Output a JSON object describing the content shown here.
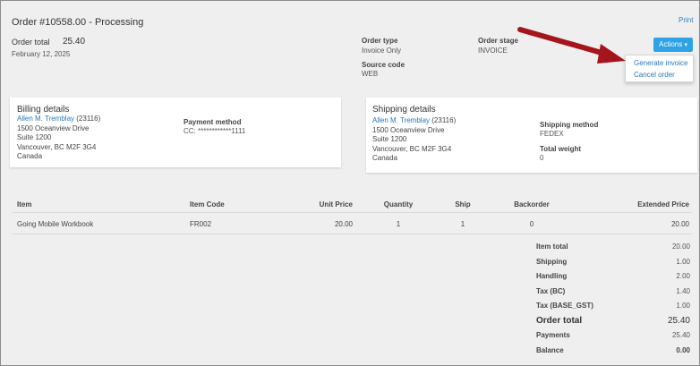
{
  "header": {
    "title": "Order #10558.00 - Processing",
    "print_label": "Print",
    "order_total_label": "Order total",
    "order_total_value": "25.40",
    "order_date": "February 12, 2025",
    "order_type_label": "Order type",
    "order_type_value": "Invoice Only",
    "source_code_label": "Source code",
    "source_code_value": "WEB",
    "order_stage_label": "Order stage",
    "order_stage_value": "INVOICE"
  },
  "actions": {
    "button_label": "Actions",
    "caret": "▾",
    "menu": [
      "Generate invoice",
      "Cancel order"
    ]
  },
  "billing": {
    "title": "Billing details",
    "customer_name": "Allen M. Tremblay",
    "customer_id": "(23116)",
    "address": [
      "1500 Oceanview Drive",
      "Suite 1200",
      "Vancouver, BC M2F 3G4",
      "Canada"
    ],
    "payment_method_label": "Payment method",
    "payment_method_value": "CC: ************1111"
  },
  "shipping": {
    "title": "Shipping details",
    "customer_name": "Allen M. Tremblay",
    "customer_id": "(23116)",
    "address": [
      "1500 Oceanview Drive",
      "Suite 1200",
      "Vancouver, BC M2F 3G4",
      "Canada"
    ],
    "method_label": "Shipping method",
    "method_value": "FEDEX",
    "weight_label": "Total weight",
    "weight_value": "0"
  },
  "items_table": {
    "headers": [
      "Item",
      "Item Code",
      "Unit Price",
      "Quantity",
      "Ship",
      "Backorder",
      "Extended Price"
    ],
    "rows": [
      {
        "item": "Going Mobile Workbook",
        "code": "FR002",
        "unit_price": "20.00",
        "quantity": "1",
        "ship": "1",
        "backorder": "0",
        "extended": "20.00"
      }
    ]
  },
  "totals": [
    {
      "label": "Item total",
      "value": "20.00"
    },
    {
      "label": "Shipping",
      "value": "1.00"
    },
    {
      "label": "Handling",
      "value": "2.00"
    },
    {
      "label": "Tax (BC)",
      "value": "1.40"
    },
    {
      "label": "Tax (BASE_GST)",
      "value": "1.00"
    },
    {
      "label": "Order total",
      "value": "25.40"
    },
    {
      "label": "Payments",
      "value": "25.40"
    },
    {
      "label": "Balance",
      "value": "0.00"
    }
  ],
  "colors": {
    "accent": "#2fa2e6",
    "link": "#2a78b8",
    "arrow": "#a5161c",
    "background": "#efefef"
  }
}
